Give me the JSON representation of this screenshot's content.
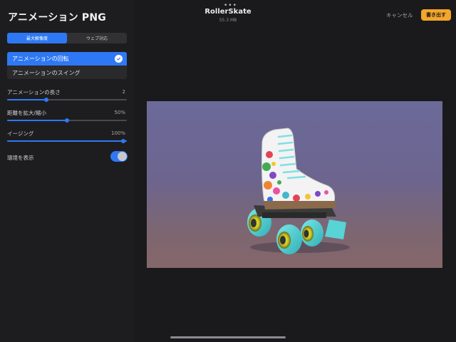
{
  "sidebar": {
    "title": "アニメーション PNG",
    "segment": {
      "options": [
        "最大解像度",
        "ウェブ対応"
      ],
      "selected_index": 0
    },
    "animation_options": [
      {
        "label": "アニメーションの回転",
        "selected": true
      },
      {
        "label": "アニメーションのスイング",
        "selected": false
      }
    ],
    "sliders": [
      {
        "label": "アニメーションの長さ",
        "value_text": "2",
        "fraction": 0.33
      },
      {
        "label": "距離を拡大/縮小",
        "value_text": "50%",
        "fraction": 0.5
      },
      {
        "label": "イージング",
        "value_text": "100%",
        "fraction": 1.0
      }
    ],
    "toggle": {
      "label": "環境を表示",
      "on": true
    }
  },
  "header": {
    "more_icon": "more-dots-icon",
    "doc_title": "RollerSkate",
    "doc_size": "55.3 MB",
    "cancel_label": "キャンセル",
    "export_label": "書き出す"
  },
  "preview": {
    "subject": "roller skate 3D model",
    "colors": {
      "boot": "#f2f2f2",
      "wheels": "#58d3d6",
      "laces": "#7fe0e3",
      "sole": "#8a6a4a"
    }
  },
  "colors": {
    "accent": "#2f78f5",
    "export_button": "#f4a52a",
    "sidebar_bg": "#1d1d1f"
  }
}
